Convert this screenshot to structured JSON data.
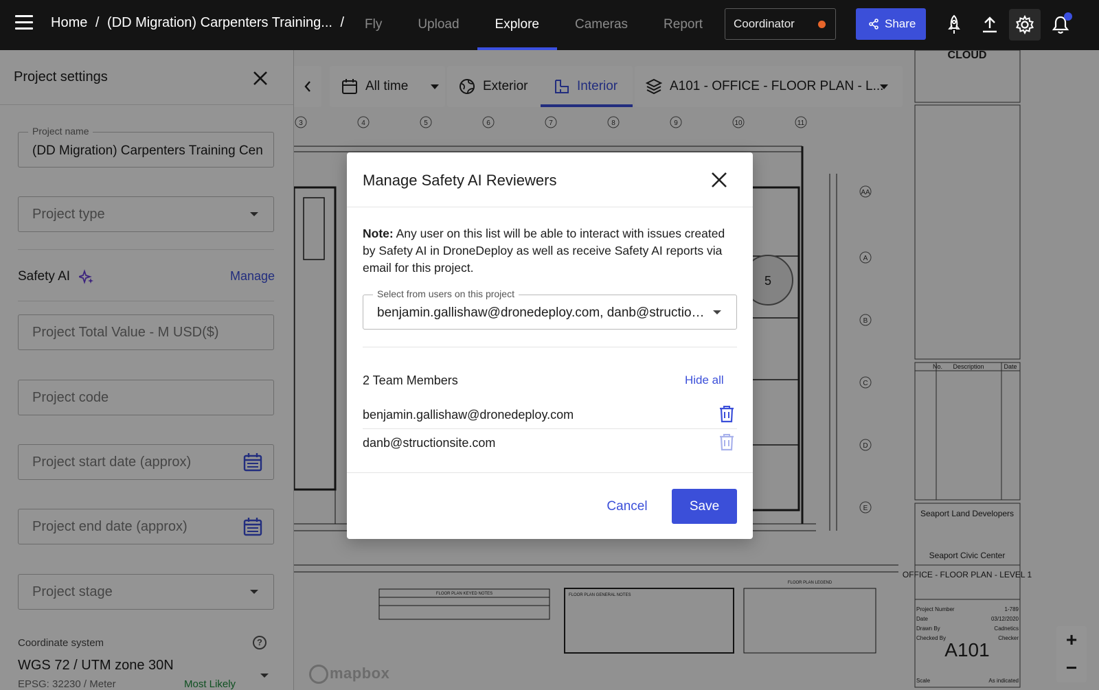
{
  "topbar": {
    "breadcrumb": [
      "Home",
      "/",
      "(DD Migration) Carpenters Training...",
      "/"
    ],
    "tabs": [
      {
        "label": "Fly",
        "active": false
      },
      {
        "label": "Upload",
        "active": false
      },
      {
        "label": "Explore",
        "active": true
      },
      {
        "label": "Cameras",
        "active": false
      },
      {
        "label": "Report",
        "active": false
      }
    ],
    "role": "Coordinator",
    "share_label": "Share",
    "icons": [
      "rocket-icon",
      "upload-icon",
      "gear-icon",
      "bell-icon"
    ]
  },
  "map": {
    "time_filter": "All time",
    "exterior_label": "Exterior",
    "interior_label": "Interior",
    "layer_label": "A101 - OFFICE - FLOOR PLAN - L...",
    "mapbox": "mapbox",
    "zoom_in": "+",
    "zoom_out": "−",
    "room_number": "5",
    "grid_numbers": [
      "3",
      "4",
      "5",
      "6",
      "7",
      "8",
      "9",
      "10",
      "11"
    ],
    "grid_letters": [
      "AA",
      "A",
      "B",
      "C",
      "D",
      "E"
    ],
    "title_block": {
      "cloud": "CLOUD",
      "developer": "Seaport Land Developers",
      "project": "Seaport Civic Center",
      "sheet_title": "OFFICE - FLOOR PLAN - LEVEL 1",
      "sheet_number": "A101",
      "rev_headers": [
        "No.",
        "Description",
        "Date"
      ],
      "project_number_label": "Project Number",
      "project_number": "1-789",
      "date_label": "Date",
      "date": "03/12/2020",
      "drawn_label": "Drawn By",
      "drawn": "Cadnetics",
      "checked_label": "Checked By",
      "checked": "Checker",
      "scale_label": "Scale",
      "scale": "As indicated"
    },
    "notes_titles": [
      "FLOOR PLAN KEYED NOTES",
      "FLOOR PLAN GENERAL NOTES",
      "FLOOR PLAN LEGEND"
    ]
  },
  "panel": {
    "title": "Project settings",
    "project_name_label": "Project name",
    "project_name": "(DD Migration) Carpenters Training Cen",
    "project_type": "Project type",
    "safety_ai": "Safety AI",
    "manage": "Manage",
    "total_value": "Project Total Value - M USD($)",
    "project_code": "Project code",
    "start_date": "Project start date (approx)",
    "end_date": "Project end date (approx)",
    "project_stage": "Project stage",
    "coord_title": "Coordinate system",
    "coord_value": "WGS 72 / UTM zone 30N",
    "coord_sub": "EPSG: 32230 / Meter",
    "coord_likely": "Most Likely",
    "help": "?"
  },
  "modal": {
    "title": "Manage Safety AI Reviewers",
    "note_bold": "Note:",
    "note_text": " Any user on this list will be able to interact with issues created by Safety AI in DroneDeploy as well as receive Safety AI reports via email for this project.",
    "select_label": "Select from users on this project",
    "select_value": "benjamin.gallishaw@dronedeploy.com, danb@structionsite.com",
    "team_count": "2 Team Members",
    "hide_all": "Hide all",
    "members": [
      {
        "email": "benjamin.gallishaw@dronedeploy.com",
        "deletable": true
      },
      {
        "email": "danb@structionsite.com",
        "deletable": false
      }
    ],
    "cancel": "Cancel",
    "save": "Save"
  },
  "colors": {
    "accent": "#3b4fd9",
    "topbar": "#141414",
    "status_dot": "#e8652a",
    "success": "#1a8a3a"
  }
}
